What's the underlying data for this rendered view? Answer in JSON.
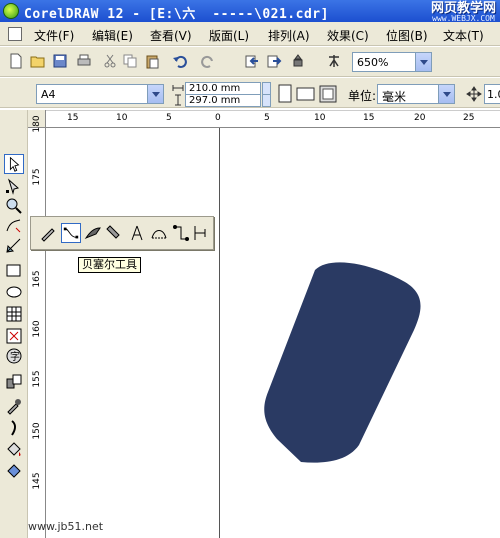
{
  "window": {
    "title": "CorelDRAW 12 - [E:\\六  -----\\021.cdr]",
    "watermark_top": "网页教学网",
    "watermark_bottom": "www.WEBJX.COM"
  },
  "menu": [
    {
      "label": "文件(F)"
    },
    {
      "label": "编辑(E)"
    },
    {
      "label": "查看(V)"
    },
    {
      "label": "版面(L)"
    },
    {
      "label": "排列(A)"
    },
    {
      "label": "效果(C)"
    },
    {
      "label": "位图(B)"
    },
    {
      "label": "文本(T)"
    }
  ],
  "standard_toolbar": {
    "zoom_value": "650%"
  },
  "property_bar": {
    "page_size": "A4",
    "width": "210.0 mm",
    "height": "297.0 mm",
    "unit_label": "单位:",
    "unit_value": "毫米",
    "nudge_value": "1.0"
  },
  "ruler": {
    "h_labels": [
      "15",
      "10",
      "5",
      "0",
      "5",
      "10",
      "15",
      "20",
      "25"
    ],
    "v_labels": [
      "180",
      "175",
      "170",
      "165",
      "160",
      "155",
      "150",
      "145"
    ]
  },
  "flyout": {
    "tooltip": "贝塞尔工具",
    "tools": [
      "freehand-tool",
      "bezier-tool",
      "artistic-media-tool",
      "pen-tool",
      "polyline-tool",
      "3-point-curve-tool",
      "interactive-connector-tool",
      "dimension-tool"
    ]
  },
  "colors": {
    "shape_fill": "#2a3a63",
    "titlebar": "#2457d6",
    "chrome": "#ece9d8"
  },
  "footer_watermark": "www.jb51.net"
}
